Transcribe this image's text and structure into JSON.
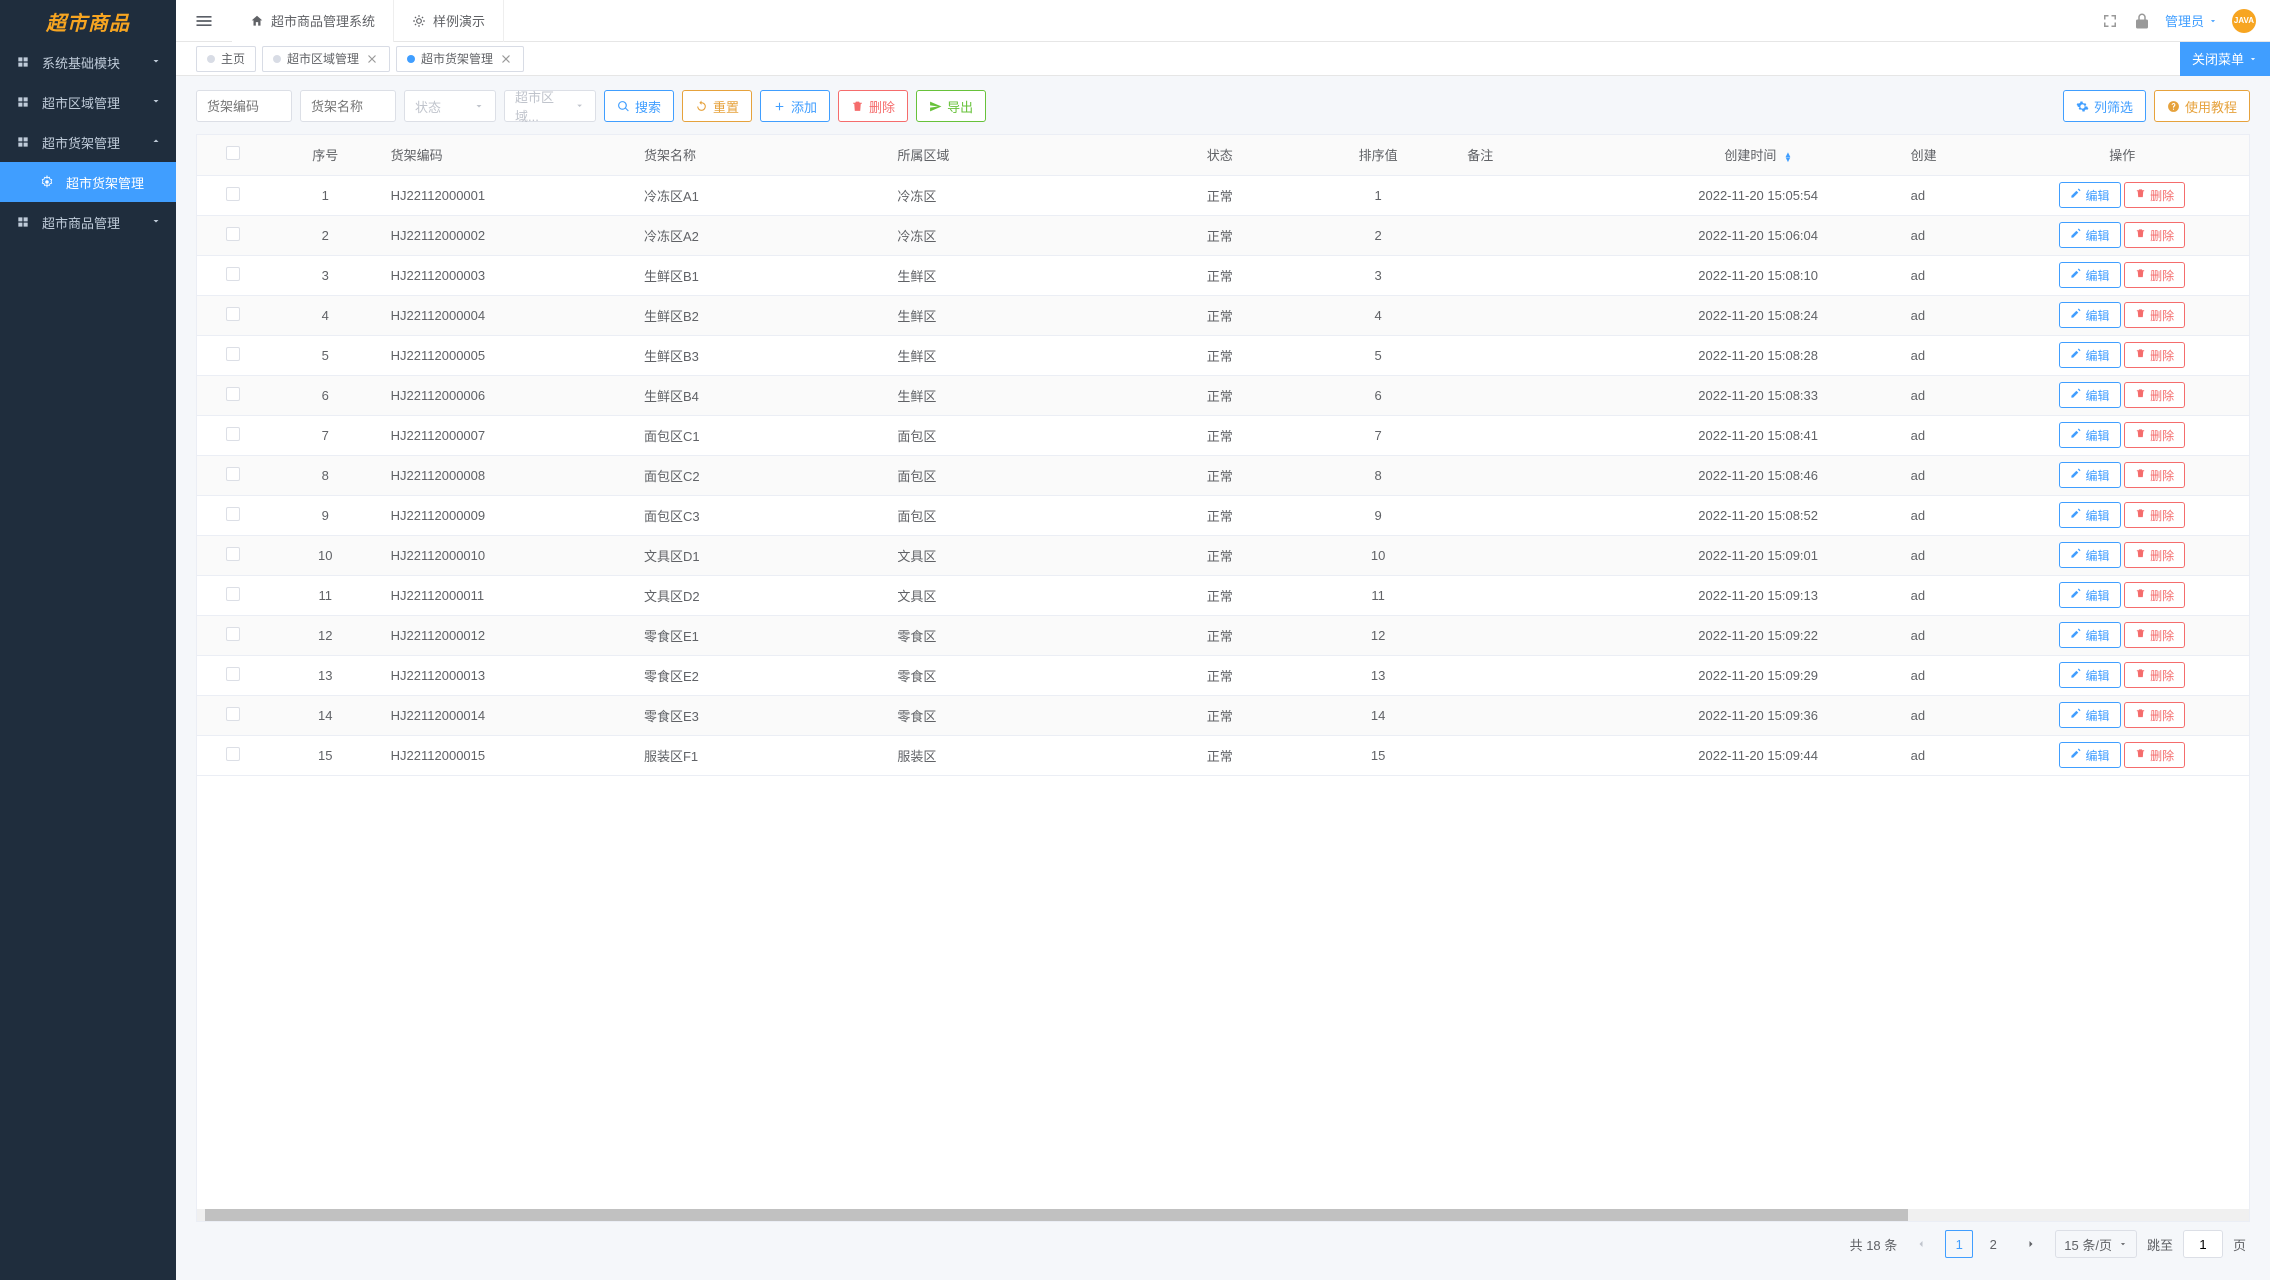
{
  "logo_text": "超市商品",
  "sidebar": [
    {
      "label": "系统基础模块",
      "icon": "terminal",
      "children": []
    },
    {
      "label": "超市区域管理",
      "icon": "grid",
      "children": []
    },
    {
      "label": "超市货架管理",
      "icon": "grid",
      "expanded": true,
      "children": [
        {
          "label": "超市货架管理",
          "active": true
        }
      ]
    },
    {
      "label": "超市商品管理",
      "icon": "grid",
      "children": []
    }
  ],
  "top_tabs": [
    {
      "label": "超市商品管理系统",
      "icon": "home"
    },
    {
      "label": "样例演示",
      "icon": "sparkle"
    }
  ],
  "top_right": {
    "user_label": "管理员",
    "avatar_text": "JAVA"
  },
  "page_tabs": [
    {
      "label": "主页",
      "closable": false,
      "active": false
    },
    {
      "label": "超市区域管理",
      "closable": true,
      "active": false
    },
    {
      "label": "超市货架管理",
      "closable": true,
      "active": true
    }
  ],
  "close_menu_label": "关闭菜单",
  "filters": {
    "code_placeholder": "货架编码",
    "name_placeholder": "货架名称",
    "status_placeholder": "状态",
    "region_placeholder": "超市区域..."
  },
  "buttons": {
    "search": "搜索",
    "reset": "重置",
    "add": "添加",
    "delete": "删除",
    "export": "导出",
    "columns": "列筛选",
    "tutorial": "使用教程",
    "edit": "编辑",
    "row_delete": "删除"
  },
  "columns": {
    "index": "序号",
    "code": "货架编码",
    "name": "货架名称",
    "region": "所属区域",
    "status": "状态",
    "sort": "排序值",
    "note": "备注",
    "time": "创建时间",
    "creator": "创建",
    "ops": "操作"
  },
  "rows": [
    {
      "idx": 1,
      "code": "HJ22112000001",
      "name": "冷冻区A1",
      "region": "冷冻区",
      "status": "正常",
      "sort": 1,
      "note": "",
      "time": "2022-11-20 15:05:54",
      "creator": "ad"
    },
    {
      "idx": 2,
      "code": "HJ22112000002",
      "name": "冷冻区A2",
      "region": "冷冻区",
      "status": "正常",
      "sort": 2,
      "note": "",
      "time": "2022-11-20 15:06:04",
      "creator": "ad"
    },
    {
      "idx": 3,
      "code": "HJ22112000003",
      "name": "生鲜区B1",
      "region": "生鲜区",
      "status": "正常",
      "sort": 3,
      "note": "",
      "time": "2022-11-20 15:08:10",
      "creator": "ad"
    },
    {
      "idx": 4,
      "code": "HJ22112000004",
      "name": "生鲜区B2",
      "region": "生鲜区",
      "status": "正常",
      "sort": 4,
      "note": "",
      "time": "2022-11-20 15:08:24",
      "creator": "ad"
    },
    {
      "idx": 5,
      "code": "HJ22112000005",
      "name": "生鲜区B3",
      "region": "生鲜区",
      "status": "正常",
      "sort": 5,
      "note": "",
      "time": "2022-11-20 15:08:28",
      "creator": "ad"
    },
    {
      "idx": 6,
      "code": "HJ22112000006",
      "name": "生鲜区B4",
      "region": "生鲜区",
      "status": "正常",
      "sort": 6,
      "note": "",
      "time": "2022-11-20 15:08:33",
      "creator": "ad"
    },
    {
      "idx": 7,
      "code": "HJ22112000007",
      "name": "面包区C1",
      "region": "面包区",
      "status": "正常",
      "sort": 7,
      "note": "",
      "time": "2022-11-20 15:08:41",
      "creator": "ad"
    },
    {
      "idx": 8,
      "code": "HJ22112000008",
      "name": "面包区C2",
      "region": "面包区",
      "status": "正常",
      "sort": 8,
      "note": "",
      "time": "2022-11-20 15:08:46",
      "creator": "ad"
    },
    {
      "idx": 9,
      "code": "HJ22112000009",
      "name": "面包区C3",
      "region": "面包区",
      "status": "正常",
      "sort": 9,
      "note": "",
      "time": "2022-11-20 15:08:52",
      "creator": "ad"
    },
    {
      "idx": 10,
      "code": "HJ22112000010",
      "name": "文具区D1",
      "region": "文具区",
      "status": "正常",
      "sort": 10,
      "note": "",
      "time": "2022-11-20 15:09:01",
      "creator": "ad"
    },
    {
      "idx": 11,
      "code": "HJ22112000011",
      "name": "文具区D2",
      "region": "文具区",
      "status": "正常",
      "sort": 11,
      "note": "",
      "time": "2022-11-20 15:09:13",
      "creator": "ad"
    },
    {
      "idx": 12,
      "code": "HJ22112000012",
      "name": "零食区E1",
      "region": "零食区",
      "status": "正常",
      "sort": 12,
      "note": "",
      "time": "2022-11-20 15:09:22",
      "creator": "ad"
    },
    {
      "idx": 13,
      "code": "HJ22112000013",
      "name": "零食区E2",
      "region": "零食区",
      "status": "正常",
      "sort": 13,
      "note": "",
      "time": "2022-11-20 15:09:29",
      "creator": "ad"
    },
    {
      "idx": 14,
      "code": "HJ22112000014",
      "name": "零食区E3",
      "region": "零食区",
      "status": "正常",
      "sort": 14,
      "note": "",
      "time": "2022-11-20 15:09:36",
      "creator": "ad"
    },
    {
      "idx": 15,
      "code": "HJ22112000015",
      "name": "服装区F1",
      "region": "服装区",
      "status": "正常",
      "sort": 15,
      "note": "",
      "time": "2022-11-20 15:09:44",
      "creator": "ad"
    }
  ],
  "pagination": {
    "total_label": "共 18 条",
    "pages": [
      1,
      2
    ],
    "current": 1,
    "size_label": "15 条/页",
    "jump_label": "跳至",
    "jump_value": "1",
    "page_suffix": "页"
  }
}
